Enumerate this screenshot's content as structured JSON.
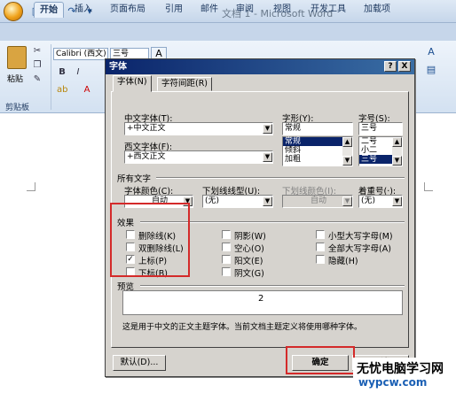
{
  "word": {
    "title": "文档 1 - Microsoft Word",
    "tabs": [
      "开始",
      "插入",
      "页面布局",
      "引用",
      "邮件",
      "审阅",
      "视图",
      "开发工具",
      "加载项"
    ],
    "ribbon": {
      "font_name": "Calibri (西文)",
      "font_size": "三号",
      "paste_label": "粘贴",
      "clipboard_label": "剪贴板"
    }
  },
  "dialog": {
    "title": "字体",
    "help_btn": "?",
    "close_btn": "X",
    "tabs": [
      "字体(N)",
      "字符间距(R)"
    ],
    "chinese_font_label": "中文字体(T):",
    "chinese_font_value": "+中文正文",
    "western_font_label": "西文字体(F):",
    "western_font_value": "+西文正文",
    "style_label": "字形(Y):",
    "style_value": "常规",
    "style_list": [
      "常规",
      "倾斜",
      "加粗"
    ],
    "size_label": "字号(S):",
    "size_value": "三号",
    "size_list": [
      "二号",
      "小二",
      "三号"
    ],
    "all_text_label": "所有文字",
    "font_color_label": "字体颜色(C):",
    "font_color_value": "自动",
    "underline_type_label": "下划线线型(U):",
    "underline_type_value": "(无)",
    "underline_color_label": "下划线颜色(I):",
    "underline_color_value": "自动",
    "emphasis_label": "着重号(·):",
    "emphasis_value": "(无)",
    "effects_label": "效果",
    "effects": [
      {
        "label": "删除线(K)",
        "checked": false
      },
      {
        "label": "双删除线(L)",
        "checked": false
      },
      {
        "label": "上标(P)",
        "checked": true
      },
      {
        "label": "下标(B)",
        "checked": false
      },
      {
        "label": "阴影(W)",
        "checked": false
      },
      {
        "label": "空心(O)",
        "checked": false
      },
      {
        "label": "阳文(E)",
        "checked": false
      },
      {
        "label": "阴文(G)",
        "checked": false
      },
      {
        "label": "小型大写字母(M)",
        "checked": false
      },
      {
        "label": "全部大写字母(A)",
        "checked": false
      },
      {
        "label": "隐藏(H)",
        "checked": false
      }
    ],
    "preview_label": "预览",
    "preview_text": "2",
    "preview_desc": "这是用于中文的正文主题字体。当前文档主题定义将使用哪种字体。",
    "default_btn": "默认(D)...",
    "ok_btn": "确定",
    "cancel_btn": "取消"
  },
  "watermark": {
    "line1": "无忧电脑学习网",
    "line2": "wypcw.com"
  },
  "colors": {
    "highlight": "#d42a2a",
    "title_bar": "#0a246a",
    "dialog_bg": "#d6d3ce"
  }
}
